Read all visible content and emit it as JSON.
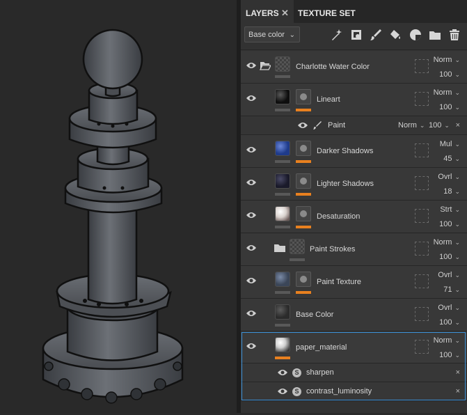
{
  "viewport": {
    "background": "#292929",
    "subject": "chess-king-watercolor-render"
  },
  "tabs": [
    {
      "label": "LAYERS",
      "active": true
    },
    {
      "label": "TEXTURE SET SETTINGS",
      "active": false
    }
  ],
  "toolbar": {
    "channel_value": "Base color",
    "tools": [
      "magic-wand-icon",
      "smart-mask-icon",
      "paint-brush-icon",
      "fill-bucket-icon",
      "effects-icon",
      "folder-icon",
      "trash-icon"
    ]
  },
  "accent_colors": {
    "mask_bar": "#e8801f",
    "selection": "#3a8fd6"
  },
  "layers": [
    {
      "name": "Charlotte Water Color",
      "blend": "Norm",
      "opacity": "100",
      "type": "folder",
      "thumb": "checker"
    },
    {
      "name": "Lineart",
      "blend": "Norm",
      "opacity": "100",
      "type": "fill",
      "thumb": "#0e0e0e",
      "mask": true
    },
    {
      "name": "Darker Shadows",
      "blend": "Mul",
      "opacity": "45",
      "type": "fill",
      "thumb": "#1f3b8a",
      "mask": true
    },
    {
      "name": "Lighter Shadows",
      "blend": "Ovrl",
      "opacity": "18",
      "type": "fill",
      "thumb": "#1a1a2a",
      "mask": true
    },
    {
      "name": "Desaturation",
      "blend": "Strt",
      "opacity": "100",
      "type": "fill",
      "thumb": "#d8d0cc",
      "mask": true
    },
    {
      "name": "Paint Strokes",
      "blend": "Norm",
      "opacity": "100",
      "type": "folder",
      "thumb": "checker"
    },
    {
      "name": "Paint Texture",
      "blend": "Ovrl",
      "opacity": "71",
      "type": "fill",
      "thumb": "#3b4658",
      "mask": true
    },
    {
      "name": "Base Color",
      "blend": "Ovrl",
      "opacity": "100",
      "type": "fill",
      "thumb": "#2b2b2b"
    },
    {
      "name": "paper_material",
      "blend": "Norm",
      "opacity": "100",
      "type": "fill",
      "thumb": "#cfcfcf",
      "selected": true
    }
  ],
  "paint_sublayer": {
    "name": "Paint",
    "blend": "Norm",
    "opacity": "100",
    "close": "×"
  },
  "effects": [
    {
      "name": "sharpen",
      "close": "×"
    },
    {
      "name": "contrast_luminosity",
      "close": "×"
    }
  ]
}
